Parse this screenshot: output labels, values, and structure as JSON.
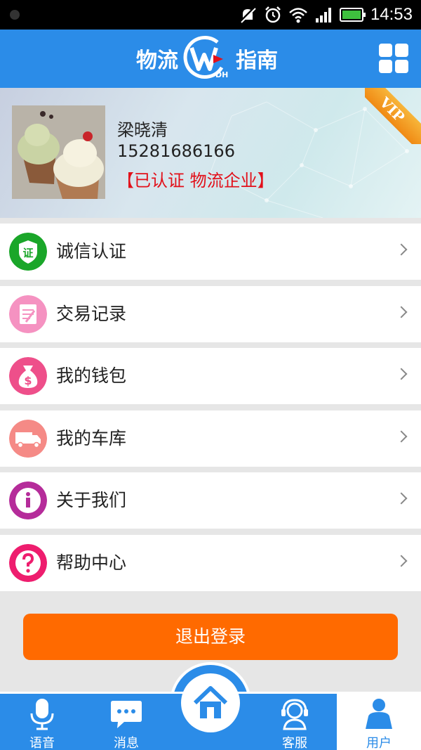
{
  "status_bar": {
    "time": "14:53"
  },
  "header": {
    "logo_left": "物流",
    "logo_right": "指南",
    "logo_mark_text": "DH",
    "menu_icon": "grid-icon"
  },
  "profile": {
    "name": "梁晓清",
    "phone": "15281686166",
    "certification": "【已认证  物流企业】",
    "badge": "VIP"
  },
  "menu": {
    "items": [
      {
        "label": "诚信认证",
        "icon": "certificate-icon",
        "color": "#1aa629"
      },
      {
        "label": "交易记录",
        "icon": "document-edit-icon",
        "color": "#f592c1"
      },
      {
        "label": "我的钱包",
        "icon": "money-bag-icon",
        "color": "#ee4f8a"
      },
      {
        "label": "我的车库",
        "icon": "truck-icon",
        "color": "#f58a86"
      },
      {
        "label": "关于我们",
        "icon": "info-icon",
        "color": "#b52c9a"
      },
      {
        "label": "帮助中心",
        "icon": "question-icon",
        "color": "#ee1d6e"
      }
    ],
    "cert_badge_text": "证"
  },
  "logout_label": "退出登录",
  "bottom_nav": {
    "items": [
      {
        "label": "语音",
        "icon": "microphone-icon"
      },
      {
        "label": "消息",
        "icon": "chat-bubble-icon"
      },
      {
        "label": "",
        "icon": "home-icon"
      },
      {
        "label": "客服",
        "icon": "headset-icon"
      },
      {
        "label": "用户",
        "icon": "user-icon",
        "active": true
      }
    ]
  },
  "colors": {
    "primary": "#2b8ce8",
    "accent": "#ff6a00",
    "cert_red": "#e2101a"
  }
}
